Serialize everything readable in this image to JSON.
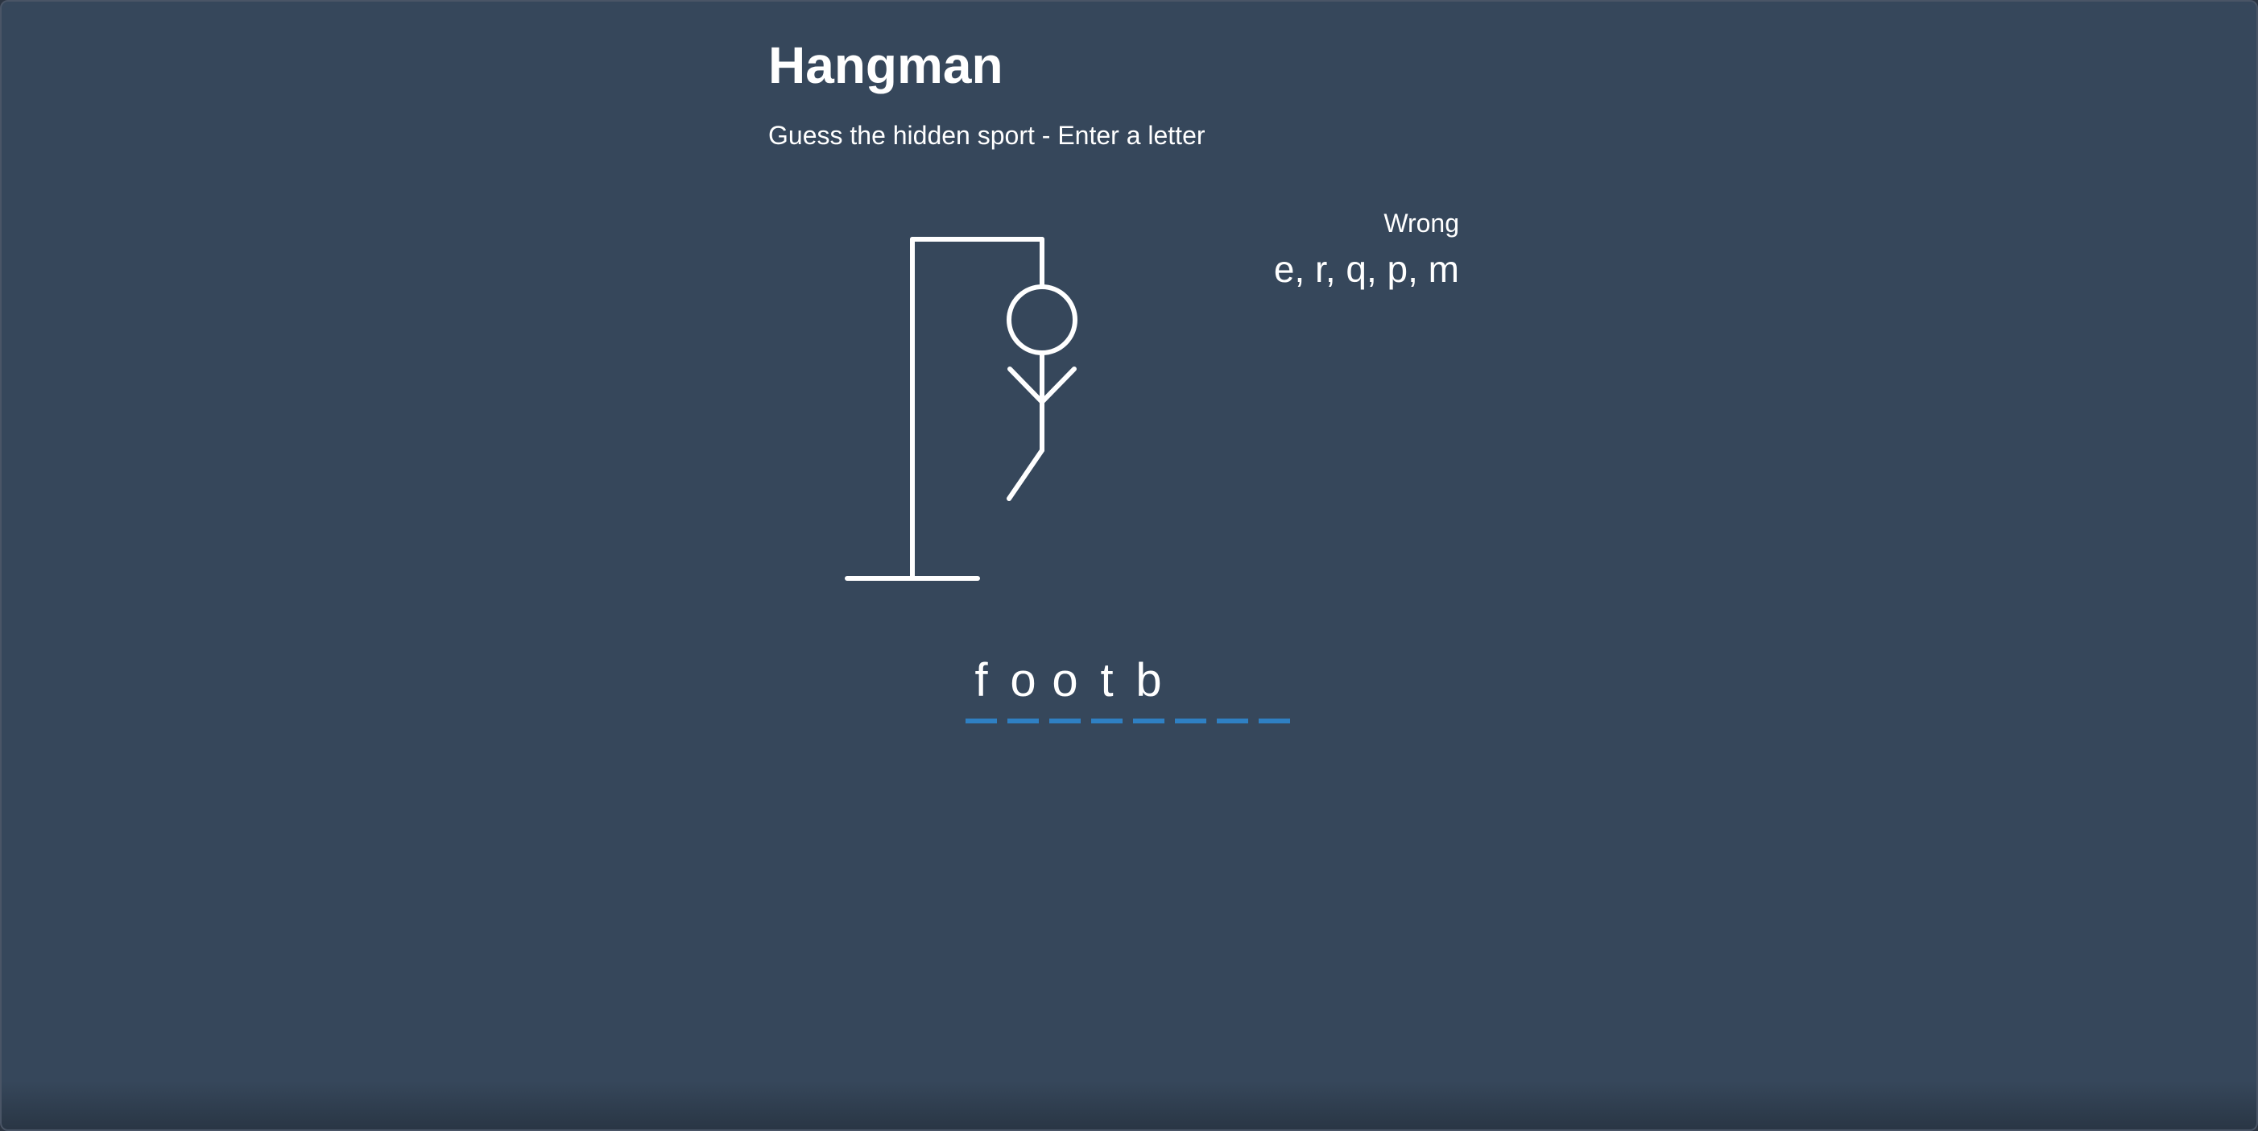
{
  "header": {
    "title": "Hangman",
    "subtitle": "Guess the hidden sport - Enter a letter"
  },
  "wrong": {
    "label": "Wrong",
    "letters": "e, r, q, p, m"
  },
  "word": {
    "slots": [
      "f",
      "o",
      "o",
      "t",
      "b",
      "",
      "",
      ""
    ]
  },
  "colors": {
    "background": "#36475b",
    "text": "#ffffff",
    "slot_underline": "#2f80c3"
  },
  "figure": {
    "wrong_count": 5,
    "parts_shown": [
      "head",
      "body",
      "left-arm",
      "right-arm",
      "left-leg"
    ]
  }
}
